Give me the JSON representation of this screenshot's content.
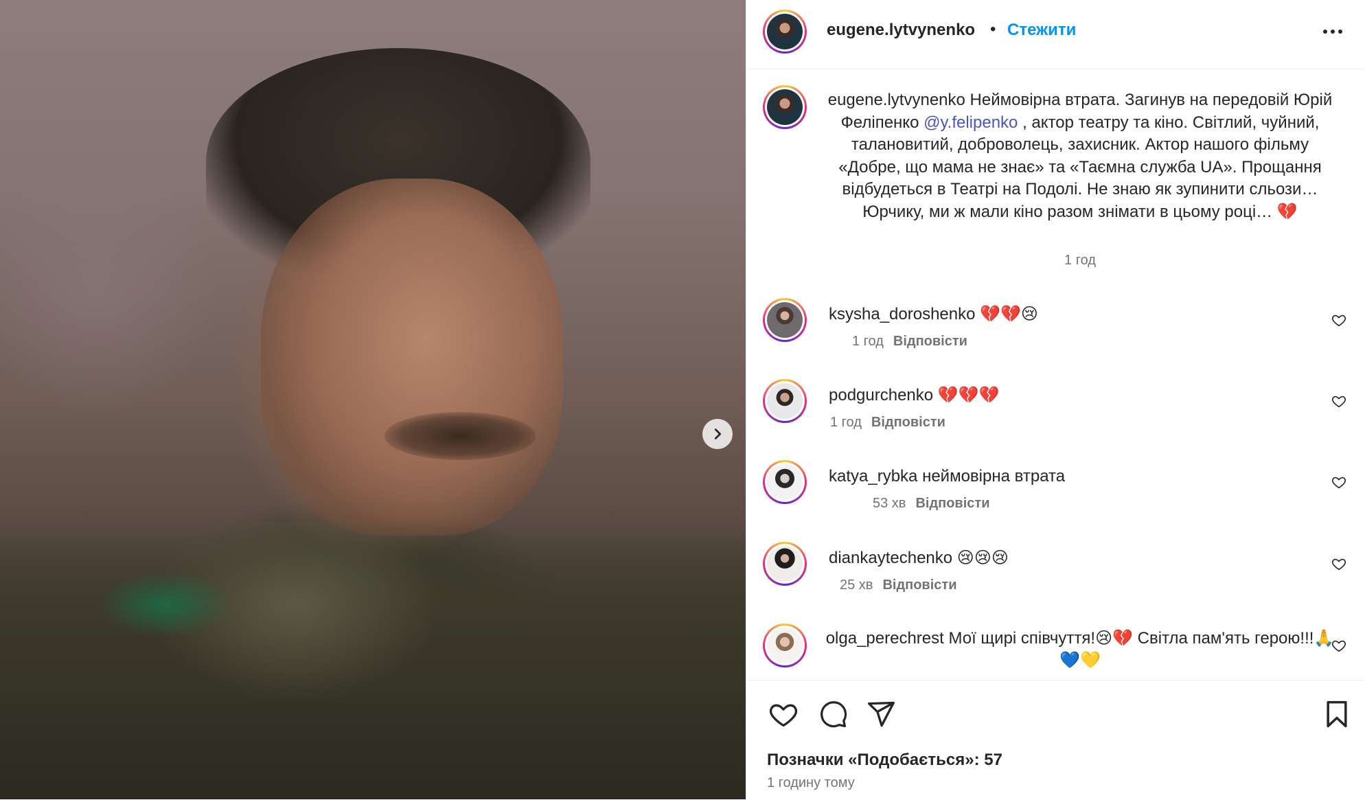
{
  "post": {
    "owner": "eugene.lytvynenko",
    "follow_label": "Стежити",
    "separator": "•",
    "more_icon": "more-horizontal-icon",
    "caption": {
      "username": "eugene.lytvynenko",
      "text_part1": " Неймовірна втрата. Загинув на передовій Юрій Феліпенко ",
      "mention": "@y.felipenko",
      "text_part2": " , актор театру та кіно. Світлий, чуйний, талановитий, доброволець, захисник. Актор нашого фільму «Добре, що мама не знає» та «Таємна служба UA». Прощання відбудеться в Театрі на Подолі. Не знаю як зупинити сльози… Юрчику, ми ж мали кіно разом знімати в цьому році… 💔",
      "time": "1 год"
    },
    "likes_label": "Позначки «Подобається»: 57",
    "posted_ago": "1 годину тому"
  },
  "comments": [
    {
      "username": "ksysha_doroshenko",
      "text": " 💔💔😢",
      "time": "1 год",
      "reply": "Відповісти"
    },
    {
      "username": "podgurchenko",
      "text": " 💔💔💔",
      "time": "1 год",
      "reply": "Відповісти"
    },
    {
      "username": "katya_rybka",
      "text": " неймовірна втрата",
      "time": "53 хв",
      "reply": "Відповісти"
    },
    {
      "username": "diankaytechenko",
      "text": " 😢😢😢",
      "time": "25 хв",
      "reply": "Відповісти"
    },
    {
      "username": "olga_perechrest",
      "text": " Мої щирі співчуття!😢💔 Світла пам'ять герою!!!🙏💙💛"
    }
  ],
  "colors": {
    "link_blue": "#0095f6",
    "mention": "#4a54c4",
    "muted_text": "#737373",
    "text": "#262626"
  }
}
